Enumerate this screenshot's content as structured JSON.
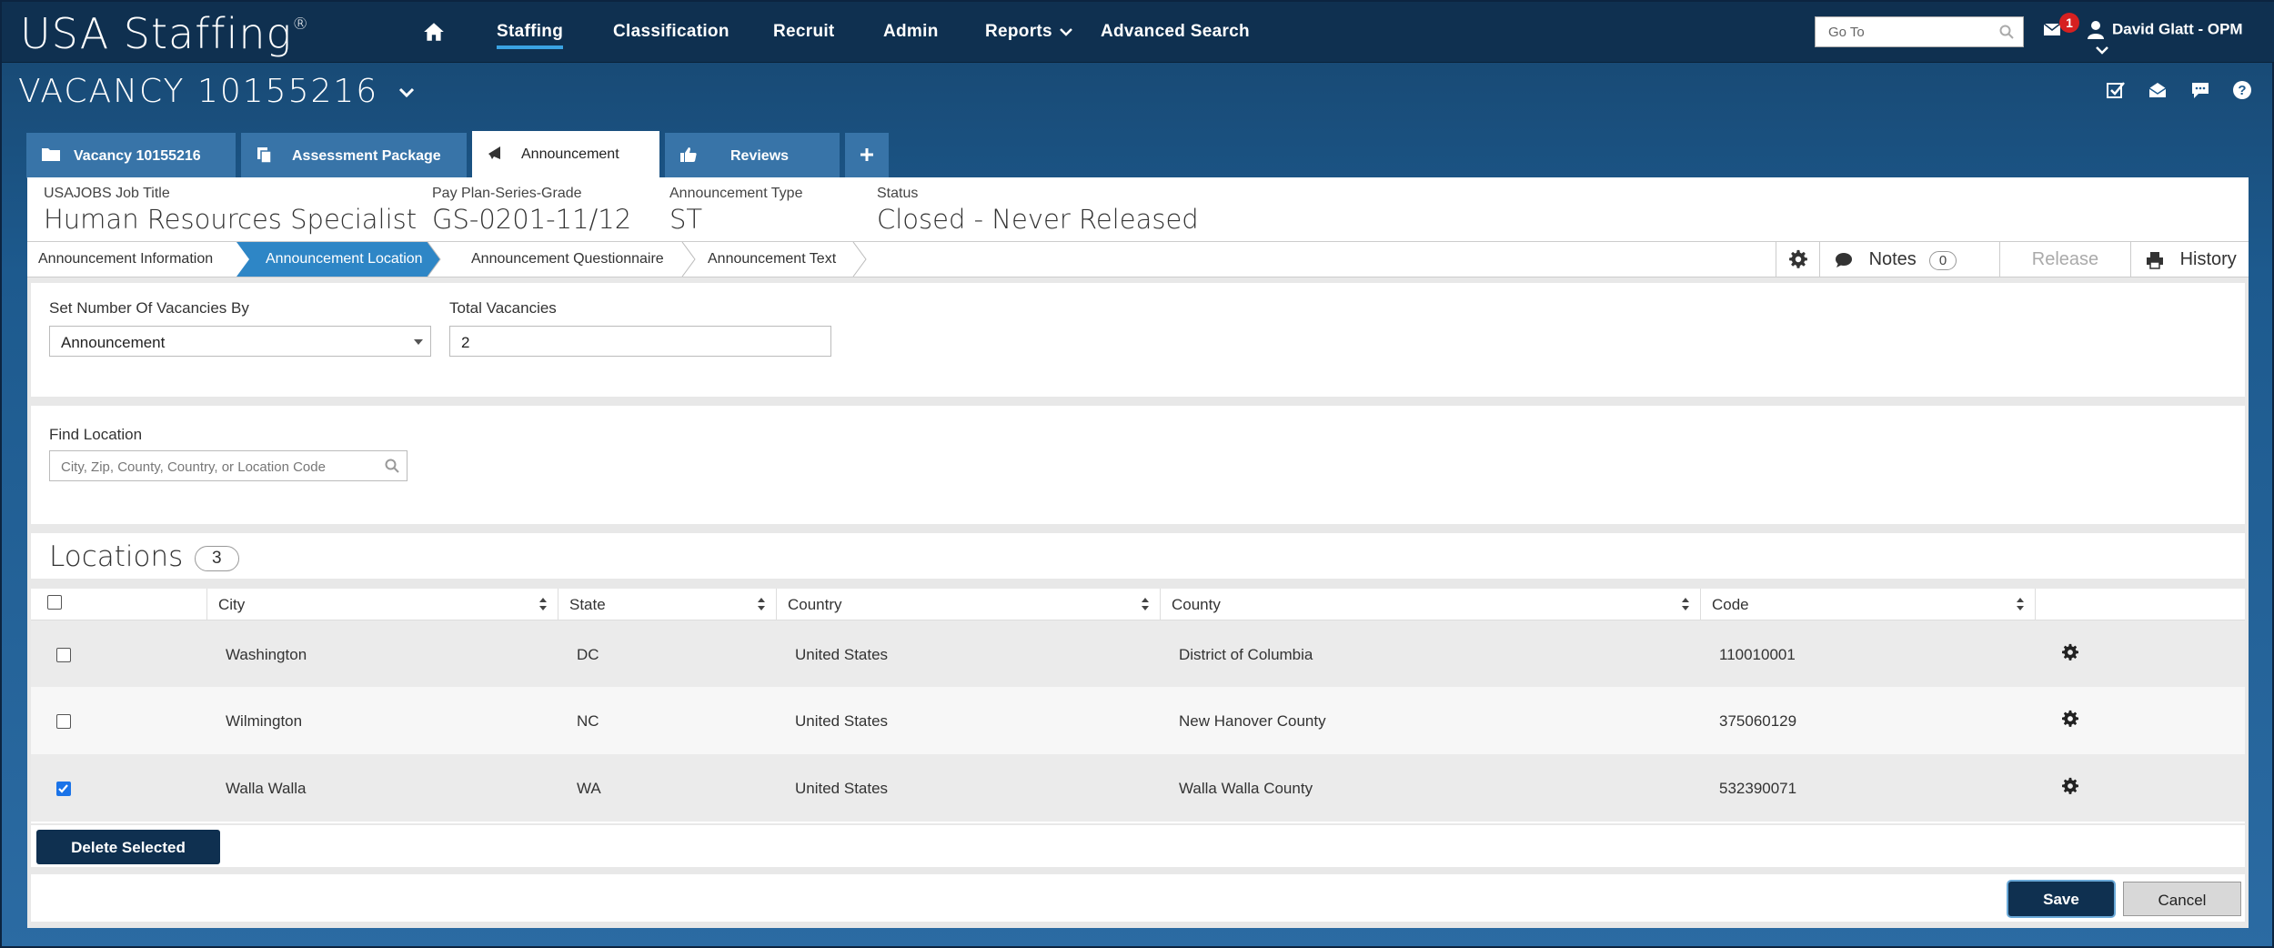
{
  "app": {
    "logo": "USA Staffing",
    "logo_mark": "®"
  },
  "nav": {
    "items": [
      {
        "label": "Staffing"
      },
      {
        "label": "Classification"
      },
      {
        "label": "Recruit"
      },
      {
        "label": "Admin"
      },
      {
        "label": "Reports"
      },
      {
        "label": "Advanced Search"
      }
    ],
    "goto_placeholder": "Go To",
    "mail_badge": "1",
    "user_name": "David Glatt - OPM"
  },
  "vacancy": {
    "title": "VACANCY 10155216"
  },
  "tabs": [
    {
      "label": "Vacancy 10155216",
      "icon": "folder-icon"
    },
    {
      "label": "Assessment Package",
      "icon": "copy-icon"
    },
    {
      "label": "Announcement",
      "icon": "megaphone-icon"
    },
    {
      "label": "Reviews",
      "icon": "thumbs-up-icon"
    }
  ],
  "header": {
    "job_title_label": "USAJOBS Job Title",
    "job_title": "Human Resources Specialist",
    "ppsg_label": "Pay Plan-Series-Grade",
    "ppsg": "GS-0201-11/12",
    "type_label": "Announcement Type",
    "type": "ST",
    "status_label": "Status",
    "status": "Closed - Never Released"
  },
  "steps": [
    {
      "label": "Announcement Information"
    },
    {
      "label": "Announcement Location"
    },
    {
      "label": "Announcement Questionnaire"
    },
    {
      "label": "Announcement Text"
    }
  ],
  "actions": {
    "notes_label": "Notes",
    "notes_count": "0",
    "release_label": "Release",
    "history_label": "History"
  },
  "form": {
    "vacancies_by_label": "Set Number Of Vacancies By",
    "vacancies_by_value": "Announcement",
    "total_label": "Total Vacancies",
    "total_value": "2",
    "find_label": "Find Location",
    "find_placeholder": "City, Zip, County, Country, or Location Code"
  },
  "locations": {
    "title": "Locations",
    "count": "3",
    "columns": [
      "City",
      "State",
      "Country",
      "County",
      "Code"
    ],
    "rows": [
      {
        "city": "Washington",
        "state": "DC",
        "country": "United States",
        "county": "District of Columbia",
        "code": "110010001",
        "checked": false
      },
      {
        "city": "Wilmington",
        "state": "NC",
        "country": "United States",
        "county": "New Hanover County",
        "code": "375060129",
        "checked": false
      },
      {
        "city": "Walla Walla",
        "state": "WA",
        "country": "United States",
        "county": "Walla Walla County",
        "code": "532390071",
        "checked": true
      }
    ]
  },
  "buttons": {
    "delete_selected": "Delete Selected",
    "save": "Save",
    "cancel": "Cancel"
  },
  "colors": {
    "nav_bg": "#0f3050",
    "active_step": "#2e86c6",
    "accent": "#3aa3e3",
    "badge": "#d62020"
  }
}
